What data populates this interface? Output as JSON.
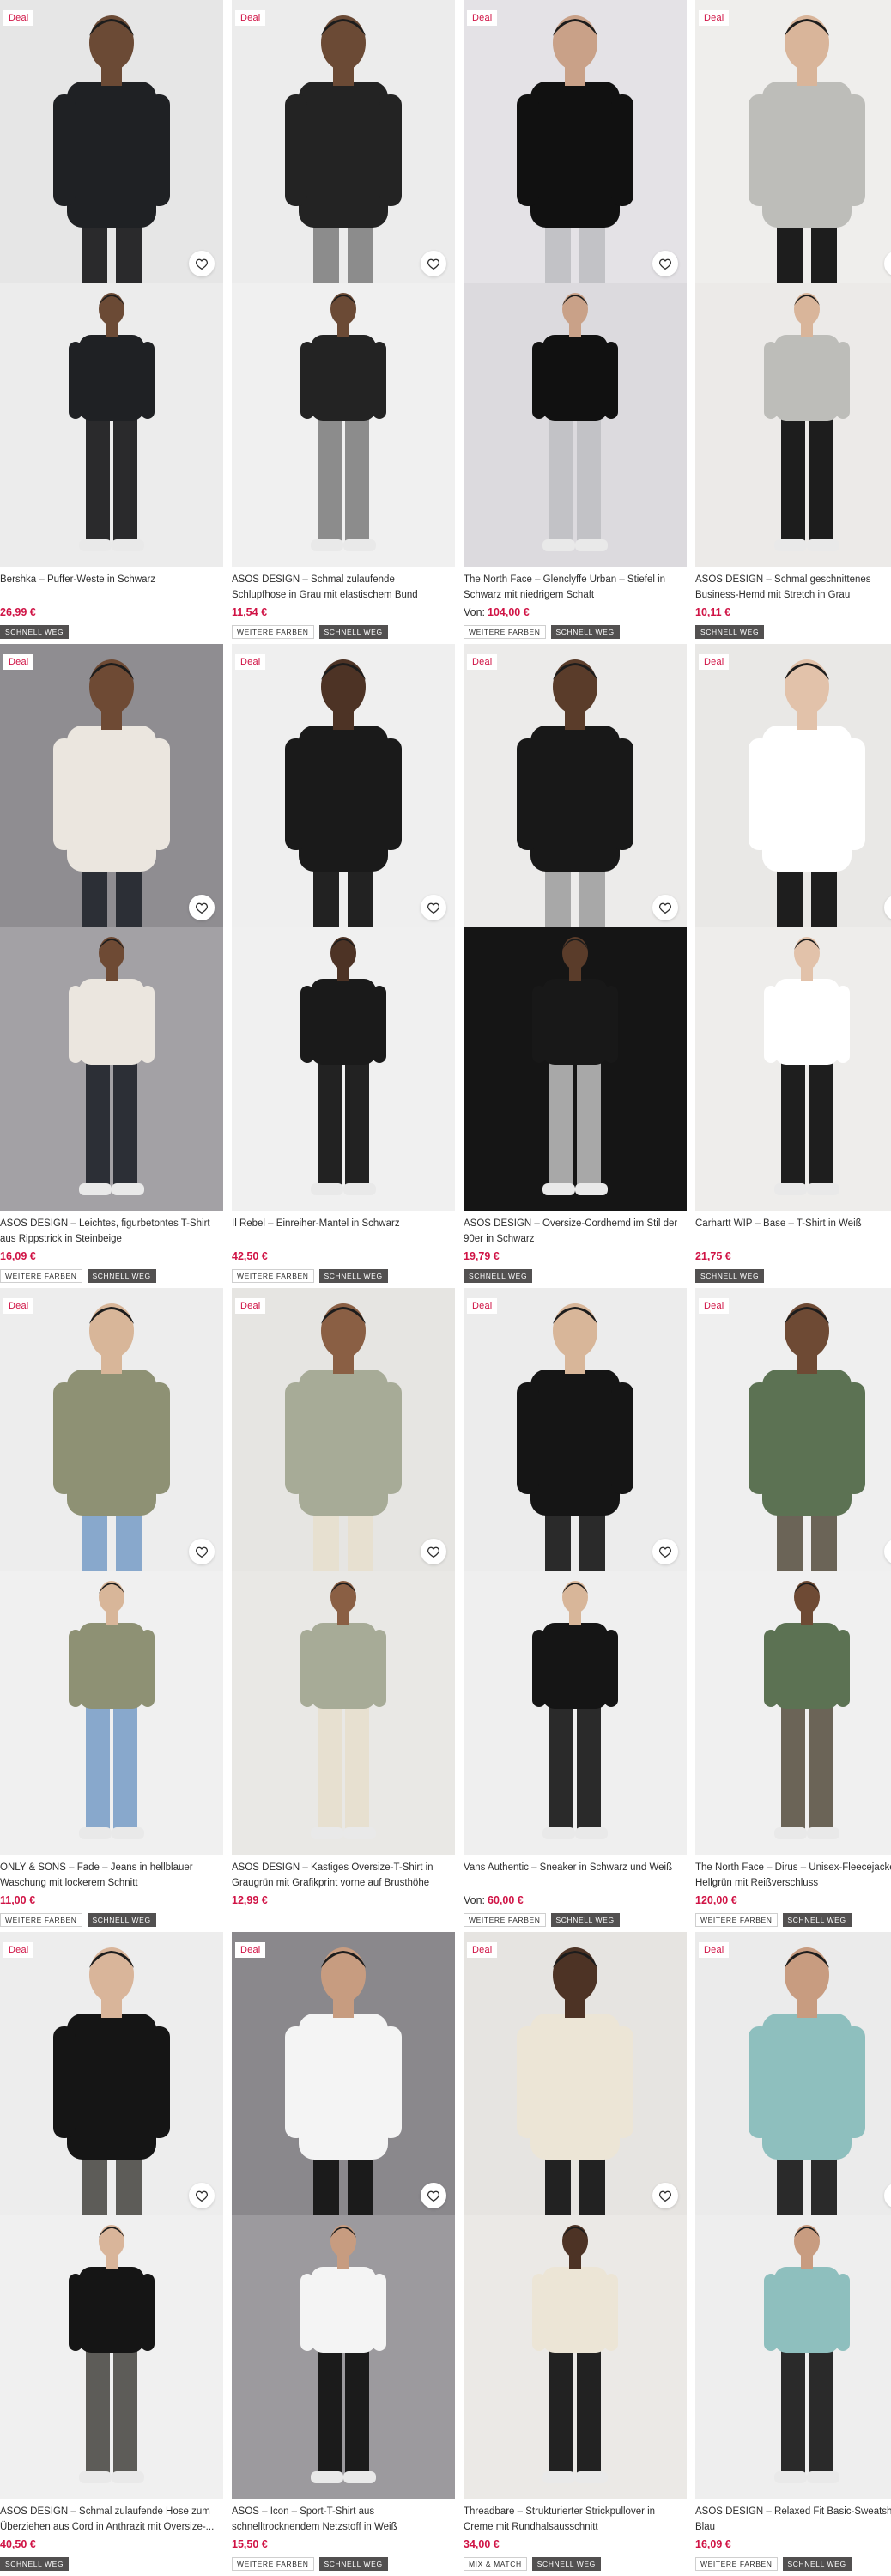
{
  "deal_label": "Deal",
  "from_label": "Von:",
  "products": [
    {
      "title": "Bershka – Puffer-Weste in Schwarz",
      "price": "26,99 €",
      "deal": true,
      "price_prefix": false,
      "tags": [
        {
          "label": "SCHNELL WEG",
          "style": "dark"
        }
      ],
      "colors": {
        "bg1": "#e6e6e6",
        "bg2": "#ececec",
        "item": "#1f2124",
        "legs": "#2a2a2c",
        "skin": "#6b4a35"
      }
    },
    {
      "title": "ASOS DESIGN – Schmal zulaufende Schlupfhose in Grau mit elastischem Bund",
      "price": "11,54 €",
      "deal": true,
      "price_prefix": false,
      "tags": [
        {
          "label": "WEITERE FARBEN",
          "style": "light"
        },
        {
          "label": "SCHNELL WEG",
          "style": "dark"
        }
      ],
      "colors": {
        "bg1": "#ececec",
        "bg2": "#f0f0f0",
        "item": "#232323",
        "legs": "#8c8c8c",
        "skin": "#6b4a35"
      }
    },
    {
      "title": "The North Face – Glenclyffe Urban – Stiefel in Schwarz mit niedrigem Schaft",
      "price": "104,00 €",
      "deal": true,
      "price_prefix": true,
      "tags": [
        {
          "label": "WEITERE FARBEN",
          "style": "light"
        },
        {
          "label": "SCHNELL WEG",
          "style": "dark"
        }
      ],
      "colors": {
        "bg1": "#e4e2e6",
        "bg2": "#dcdade",
        "item": "#111111",
        "legs": "#c2c2c6",
        "skin": "#c9a188"
      }
    },
    {
      "title": "ASOS DESIGN – Schmal geschnittenes Business-Hemd mit Stretch in Grau",
      "price": "10,11 €",
      "deal": true,
      "price_prefix": false,
      "tags": [
        {
          "label": "SCHNELL WEG",
          "style": "dark"
        }
      ],
      "colors": {
        "bg1": "#efeeec",
        "bg2": "#eceae8",
        "item": "#bdbdb9",
        "legs": "#1d1d1d",
        "skin": "#d9b59a"
      }
    },
    {
      "title": "ASOS DESIGN – Leichtes, figurbetontes T-Shirt aus Rippstrick in Steinbeige",
      "price": "16,09 €",
      "deal": true,
      "price_prefix": false,
      "tags": [
        {
          "label": "WEITERE FARBEN",
          "style": "light"
        },
        {
          "label": "SCHNELL WEG",
          "style": "dark"
        }
      ],
      "colors": {
        "bg1": "#8f8d91",
        "bg2": "#a3a1a5",
        "item": "#ebe6df",
        "legs": "#2c2f36",
        "skin": "#6e4a34"
      }
    },
    {
      "title": "Il Rebel – Einreiher-Mantel in Schwarz",
      "price": "42,50 €",
      "deal": true,
      "price_prefix": false,
      "tags": [
        {
          "label": "WEITERE FARBEN",
          "style": "light"
        },
        {
          "label": "SCHNELL WEG",
          "style": "dark"
        }
      ],
      "colors": {
        "bg1": "#efefef",
        "bg2": "#f0f0f0",
        "item": "#1a1a1a",
        "legs": "#222222",
        "skin": "#4d3325"
      }
    },
    {
      "title": "ASOS DESIGN – Oversize-Cordhemd im Stil der 90er in Schwarz",
      "price": "19,79 €",
      "deal": true,
      "price_prefix": false,
      "tags": [
        {
          "label": "SCHNELL WEG",
          "style": "dark"
        }
      ],
      "colors": {
        "bg1": "#ecebea",
        "bg2": "#151515",
        "item": "#181818",
        "legs": "#a8a8a8",
        "skin": "#5a3c2a"
      }
    },
    {
      "title": "Carhartt WIP – Base – T-Shirt in Weiß",
      "price": "21,75 €",
      "deal": true,
      "price_prefix": false,
      "tags": [
        {
          "label": "SCHNELL WEG",
          "style": "dark"
        }
      ],
      "colors": {
        "bg1": "#e9e8e6",
        "bg2": "#eeedeb",
        "item": "#ffffff",
        "legs": "#1e1e1e",
        "skin": "#e2c2aa"
      }
    },
    {
      "title": "ONLY & SONS – Fade – Jeans in hellblauer Waschung mit lockerem Schnitt",
      "price": "11,00 €",
      "deal": true,
      "price_prefix": false,
      "tags": [
        {
          "label": "WEITERE FARBEN",
          "style": "light"
        },
        {
          "label": "SCHNELL WEG",
          "style": "dark"
        }
      ],
      "colors": {
        "bg1": "#ededed",
        "bg2": "#f0f0f0",
        "item": "#8e9174",
        "legs": "#88a8cc",
        "skin": "#d8b699"
      }
    },
    {
      "title": "ASOS DESIGN – Kastiges Oversize-T-Shirt in Graugrün mit Grafikprint vorne auf Brusthöhe",
      "price": "12,99 €",
      "deal": true,
      "price_prefix": false,
      "tags": [],
      "colors": {
        "bg1": "#e6e5e2",
        "bg2": "#e9e8e5",
        "item": "#a7ab97",
        "legs": "#e7e0d0",
        "skin": "#8a5f44"
      }
    },
    {
      "title": "Vans Authentic – Sneaker in Schwarz und Weiß",
      "price": "60,00 €",
      "deal": true,
      "price_prefix": true,
      "tags": [
        {
          "label": "WEITERE FARBEN",
          "style": "light"
        },
        {
          "label": "SCHNELL WEG",
          "style": "dark"
        }
      ],
      "colors": {
        "bg1": "#ececec",
        "bg2": "#efefef",
        "item": "#151515",
        "legs": "#2a2a2a",
        "skin": "#d8b699"
      }
    },
    {
      "title": "The North Face – Dirus – Unisex-Fleecejacke in Hellgrün mit Reißverschluss",
      "price": "120,00 €",
      "deal": true,
      "price_prefix": false,
      "tags": [
        {
          "label": "WEITERE FARBEN",
          "style": "light"
        },
        {
          "label": "SCHNELL WEG",
          "style": "dark"
        }
      ],
      "colors": {
        "bg1": "#efefef",
        "bg2": "#f0f0f0",
        "item": "#5c7253",
        "legs": "#6b6457",
        "skin": "#6e4a34"
      }
    },
    {
      "title": "ASOS DESIGN – Schmal zulaufende Hose zum Überziehen aus Cord in Anthrazit mit Oversize-...",
      "price": "40,50 €",
      "deal": true,
      "price_prefix": false,
      "tags": [
        {
          "label": "SCHNELL WEG",
          "style": "dark"
        }
      ],
      "colors": {
        "bg1": "#ededed",
        "bg2": "#f0f0f0",
        "item": "#151515",
        "legs": "#5d5c58",
        "skin": "#d9b59a"
      }
    },
    {
      "title": "ASOS – Icon – Sport-T-Shirt aus schnelltrocknendem Netzstoff in Weiß",
      "price": "15,50 €",
      "deal": true,
      "price_prefix": false,
      "tags": [
        {
          "label": "WEITERE FARBEN",
          "style": "light"
        },
        {
          "label": "SCHNELL WEG",
          "style": "dark"
        }
      ],
      "colors": {
        "bg1": "#8a888c",
        "bg2": "#9c9a9e",
        "item": "#f4f4f4",
        "legs": "#1b1b1b",
        "skin": "#c79c80"
      }
    },
    {
      "title": "Threadbare – Strukturierter Strickpullover in Creme mit Rundhalsausschnitt",
      "price": "34,00 €",
      "deal": true,
      "price_prefix": false,
      "tags": [
        {
          "label": "MIX & MATCH",
          "style": "light"
        },
        {
          "label": "SCHNELL WEG",
          "style": "dark"
        }
      ],
      "colors": {
        "bg1": "#e6e4e1",
        "bg2": "#ebe9e6",
        "item": "#ece5d6",
        "legs": "#222222",
        "skin": "#4d3325"
      }
    },
    {
      "title": "ASOS DESIGN – Relaxed Fit Basic-Sweatshirt in Blau",
      "price": "16,09 €",
      "deal": true,
      "price_prefix": false,
      "tags": [
        {
          "label": "WEITERE FARBEN",
          "style": "light"
        },
        {
          "label": "SCHNELL WEG",
          "style": "dark"
        }
      ],
      "colors": {
        "bg1": "#ebebeb",
        "bg2": "#eeeeee",
        "item": "#8ebfbe",
        "legs": "#2a2a2a",
        "skin": "#c89c80"
      }
    }
  ]
}
